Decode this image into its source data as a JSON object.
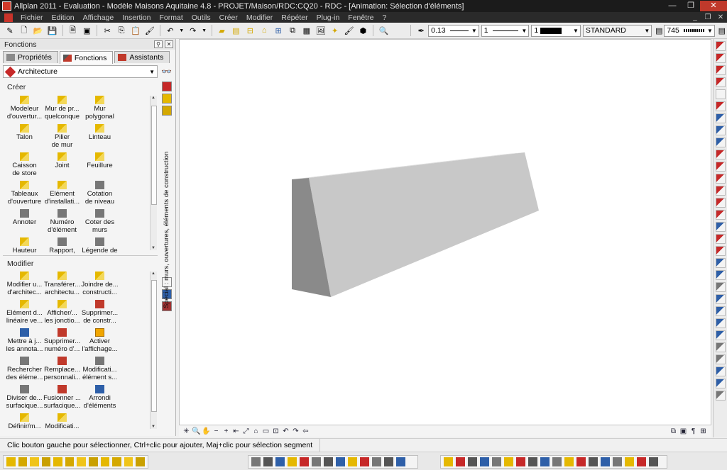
{
  "window": {
    "title": "Allplan 2011 - Evaluation - Modèle Maisons Aquitaine 4.8 - PROJET/Maison/RDC:CQ20 - RDC - [Animation: Sélection d'éléments]",
    "minimize": "—",
    "maximize": "❐",
    "close": "✕"
  },
  "menu": [
    "Fichier",
    "Edition",
    "Affichage",
    "Insertion",
    "Format",
    "Outils",
    "Créer",
    "Modifier",
    "Répéter",
    "Plug-in",
    "Fenêtre",
    "?"
  ],
  "mdi_controls": [
    "_",
    "❐",
    "✕"
  ],
  "toolbar": {
    "pen_thickness": "0.13",
    "line_type": "1",
    "color_index": "1",
    "layer": "STANDARD",
    "pattern": "745"
  },
  "panel": {
    "title": "Fonctions",
    "tabs": [
      "Propriétés",
      "Fonctions",
      "Assistants"
    ],
    "category": "Architecture",
    "vertical_label": "Spécial : murs, ouvertures, éléments de construction",
    "sections": {
      "create_label": "Créer",
      "modify_label": "Modifier"
    },
    "create_items": [
      [
        "Modeleur",
        "d'ouvertur..."
      ],
      [
        "Mur de pr...",
        "quelconque"
      ],
      [
        "Mur",
        "polygonal"
      ],
      [
        "Talon",
        ""
      ],
      [
        "Pilier",
        "de mur"
      ],
      [
        "Linteau",
        ""
      ],
      [
        "Caisson",
        "de store"
      ],
      [
        "Joint",
        ""
      ],
      [
        "Feuillure",
        ""
      ],
      [
        "Tableaux",
        "d'ouverture"
      ],
      [
        "Elément",
        "d'installati..."
      ],
      [
        "Cotation",
        "de niveau"
      ],
      [
        "Annoter",
        ""
      ],
      [
        "Numéro",
        "d'élément"
      ],
      [
        "Coter des",
        "murs"
      ],
      [
        "Hauteur",
        ""
      ],
      [
        "Rapport,",
        ""
      ],
      [
        "Légende de",
        ""
      ]
    ],
    "modify_items": [
      [
        "Modifier u...",
        "d'architec..."
      ],
      [
        "Transférer...",
        "architectu..."
      ],
      [
        "Joindre de...",
        "constructi..."
      ],
      [
        "Elément d...",
        "linéaire ve..."
      ],
      [
        "Afficher/...",
        "les jonctio..."
      ],
      [
        "Supprimer...",
        "de constr..."
      ],
      [
        "Mettre à j...",
        "les annota..."
      ],
      [
        "Supprimer...",
        "numéro d'..."
      ],
      [
        "Activer",
        "l'affichage..."
      ],
      [
        "Rechercher",
        "des éléme..."
      ],
      [
        "Remplace...",
        "personnali..."
      ],
      [
        "Modificati...",
        "élément s..."
      ],
      [
        "Diviser de...",
        "surfacique..."
      ],
      [
        "Fusionner ...",
        "surfacique..."
      ],
      [
        "Arrondi",
        "d'éléments"
      ],
      [
        "Définir/m...",
        ""
      ],
      [
        "Modificati...",
        ""
      ],
      [
        "",
        ""
      ]
    ]
  },
  "status": {
    "hint": "Clic bouton gauche pour sélectionner, Ctrl+clic pour ajouter, Maj+clic pour sélection segment"
  },
  "colors": {
    "titlebar": "#1b1b1b",
    "accent_red": "#c62828",
    "icon_yellow": "#e5b800",
    "beam_top": "#dcdcdc",
    "beam_front": "#c8c8c8",
    "beam_end": "#8a8a8a"
  }
}
